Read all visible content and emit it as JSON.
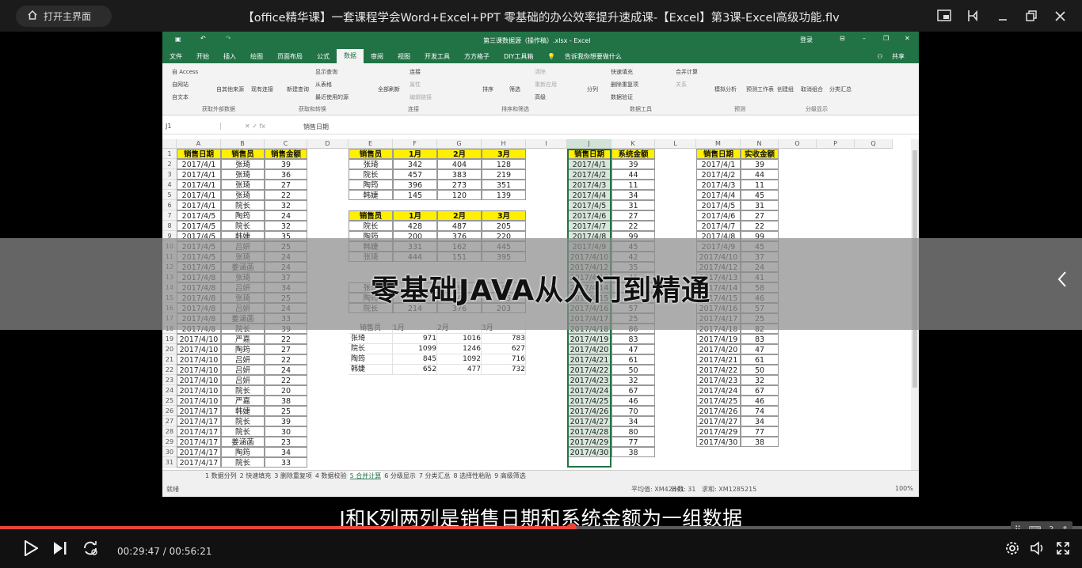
{
  "topbar": {
    "home_label": "打开主界面",
    "title": "【office精华课】一套课程学会Word+Excel+PPT  零基础的办公效率提升速成课-【Excel】第3课-Excel高级功能.flv"
  },
  "excel": {
    "doc_title": "第三课数据源（操作稿）.xlsx - Excel",
    "login": "登录",
    "share": "共享",
    "tabs": [
      "文件",
      "开始",
      "插入",
      "绘图",
      "页面布局",
      "公式",
      "数据",
      "审阅",
      "视图",
      "开发工具",
      "方方格子",
      "DIY工具箱"
    ],
    "active_tab": "数据",
    "tell_me": "告诉我你想要做什么",
    "ribbon_groups": [
      "获取外部数据",
      "获取和转换",
      "连接",
      "排序和筛选",
      "数据工具",
      "预测",
      "分级显示"
    ],
    "ribbon_items": [
      "自 Access",
      "自网站",
      "自文本",
      "自其他来源",
      "现有连接",
      "新建查询",
      "显示查询",
      "从表格",
      "最近使用的源",
      "全部刷新",
      "连接",
      "属性",
      "编辑链接",
      "排序",
      "筛选",
      "清除",
      "重新应用",
      "高级",
      "分列",
      "快速填充",
      "删除重复项",
      "数据验证",
      "合并计算",
      "关系",
      "模拟分析",
      "预测工作表",
      "创建组",
      "取消组合",
      "分类汇总"
    ],
    "name_box": "J1",
    "formula": "销售日期",
    "col_letters": [
      "A",
      "B",
      "C",
      "D",
      "E",
      "F",
      "G",
      "H",
      "I",
      "J",
      "K",
      "L",
      "M",
      "N",
      "O",
      "P",
      "Q"
    ],
    "table1_headers": [
      "销售日期",
      "销售员",
      "销售金额"
    ],
    "table1_rows": [
      [
        "2017/4/1",
        "张琦",
        "39"
      ],
      [
        "2017/4/1",
        "张琦",
        "36"
      ],
      [
        "2017/4/1",
        "张琦",
        "27"
      ],
      [
        "2017/4/1",
        "张琦",
        "22"
      ],
      [
        "2017/4/1",
        "院长",
        "32"
      ],
      [
        "2017/4/5",
        "陶筠",
        "24"
      ],
      [
        "2017/4/5",
        "院长",
        "32"
      ],
      [
        "2017/4/5",
        "韩婕",
        "35"
      ],
      [
        "2017/4/5",
        "吕妍",
        "25"
      ],
      [
        "2017/4/5",
        "张琦",
        "24"
      ],
      [
        "2017/4/5",
        "姜涵菡",
        "24"
      ],
      [
        "2017/4/8",
        "张琦",
        "37"
      ],
      [
        "2017/4/8",
        "吕妍",
        "34"
      ],
      [
        "2017/4/8",
        "张琦",
        "25"
      ],
      [
        "2017/4/8",
        "吕妍",
        "24"
      ],
      [
        "2017/4/8",
        "姜涵菡",
        "33"
      ],
      [
        "2017/4/8",
        "院长",
        "39"
      ],
      [
        "2017/4/10",
        "严嘉",
        "22"
      ],
      [
        "2017/4/10",
        "陶筠",
        "27"
      ],
      [
        "2017/4/10",
        "吕妍",
        "22"
      ],
      [
        "2017/4/10",
        "吕妍",
        "24"
      ],
      [
        "2017/4/10",
        "吕妍",
        "22"
      ],
      [
        "2017/4/10",
        "院长",
        "20"
      ],
      [
        "2017/4/10",
        "严嘉",
        "38"
      ],
      [
        "2017/4/17",
        "韩婕",
        "25"
      ],
      [
        "2017/4/17",
        "院长",
        "39"
      ],
      [
        "2017/4/17",
        "院长",
        "30"
      ],
      [
        "2017/4/17",
        "姜涵菡",
        "23"
      ],
      [
        "2017/4/17",
        "陶筠",
        "34"
      ],
      [
        "2017/4/17",
        "院长",
        "33"
      ]
    ],
    "table2_headers": [
      "销售员",
      "1月",
      "2月",
      "3月"
    ],
    "table2_rows": [
      [
        "张琦",
        "342",
        "404",
        "128"
      ],
      [
        "院长",
        "457",
        "383",
        "219"
      ],
      [
        "陶筠",
        "396",
        "273",
        "351"
      ],
      [
        "韩婕",
        "145",
        "120",
        "139"
      ]
    ],
    "table3_headers": [
      "销售员",
      "1月",
      "2月",
      "3月"
    ],
    "table3_rows": [
      [
        "院长",
        "428",
        "487",
        "205"
      ],
      [
        "陶筠",
        "200",
        "376",
        "220"
      ],
      [
        "韩婕",
        "331",
        "162",
        "445"
      ],
      [
        "张琦",
        "444",
        "151",
        "395"
      ]
    ],
    "table4_rows": [
      [
        "张琦",
        "113",
        "195",
        "140"
      ],
      [
        "陶筠",
        "249",
        "443",
        "145"
      ],
      [
        "院长",
        "214",
        "376",
        "203"
      ]
    ],
    "table5_headers": [
      "销售员",
      "1月",
      "2月",
      "3月"
    ],
    "table5_rows": [
      [
        "张琦",
        "971",
        "1016",
        "783"
      ],
      [
        "院长",
        "1099",
        "1246",
        "627"
      ],
      [
        "陶筠",
        "845",
        "1092",
        "716"
      ],
      [
        "韩婕",
        "652",
        "477",
        "732"
      ]
    ],
    "tableJ_headers": [
      "销售日期",
      "系统金额"
    ],
    "tableJ_rows": [
      [
        "2017/4/1",
        "39"
      ],
      [
        "2017/4/2",
        "44"
      ],
      [
        "2017/4/3",
        "11"
      ],
      [
        "2017/4/4",
        "34"
      ],
      [
        "2017/4/5",
        "31"
      ],
      [
        "2017/4/6",
        "27"
      ],
      [
        "2017/4/7",
        "22"
      ],
      [
        "2017/4/8",
        "99"
      ],
      [
        "2017/4/9",
        "45"
      ],
      [
        "2017/4/10",
        "42"
      ],
      [
        "2017/4/12",
        "35"
      ],
      [
        "2017/4/13",
        "46"
      ],
      [
        "2017/4/14",
        "58"
      ],
      [
        "2017/4/15",
        "46"
      ],
      [
        "2017/4/16",
        "57"
      ],
      [
        "2017/4/17",
        "25"
      ],
      [
        "2017/4/18",
        "86"
      ],
      [
        "2017/4/19",
        "83"
      ],
      [
        "2017/4/20",
        "47"
      ],
      [
        "2017/4/21",
        "61"
      ],
      [
        "2017/4/22",
        "50"
      ],
      [
        "2017/4/23",
        "32"
      ],
      [
        "2017/4/24",
        "67"
      ],
      [
        "2017/4/25",
        "46"
      ],
      [
        "2017/4/26",
        "70"
      ],
      [
        "2017/4/27",
        "34"
      ],
      [
        "2017/4/28",
        "80"
      ],
      [
        "2017/4/29",
        "77"
      ],
      [
        "2017/4/30",
        "38"
      ]
    ],
    "tableM_headers": [
      "销售日期",
      "实收金额"
    ],
    "tableM_rows": [
      [
        "2017/4/1",
        "39"
      ],
      [
        "2017/4/2",
        "44"
      ],
      [
        "2017/4/3",
        "11"
      ],
      [
        "2017/4/4",
        "45"
      ],
      [
        "2017/4/5",
        "31"
      ],
      [
        "2017/4/6",
        "27"
      ],
      [
        "2017/4/7",
        "22"
      ],
      [
        "2017/4/8",
        "99"
      ],
      [
        "2017/4/9",
        "45"
      ],
      [
        "2017/4/10",
        "37"
      ],
      [
        "2017/4/12",
        "24"
      ],
      [
        "2017/4/13",
        "41"
      ],
      [
        "2017/4/14",
        "58"
      ],
      [
        "2017/4/15",
        "46"
      ],
      [
        "2017/4/16",
        "57"
      ],
      [
        "2017/4/17",
        "25"
      ],
      [
        "2017/4/18",
        "82"
      ],
      [
        "2017/4/19",
        "83"
      ],
      [
        "2017/4/20",
        "47"
      ],
      [
        "2017/4/21",
        "61"
      ],
      [
        "2017/4/22",
        "50"
      ],
      [
        "2017/4/23",
        "32"
      ],
      [
        "2017/4/24",
        "67"
      ],
      [
        "2017/4/25",
        "46"
      ],
      [
        "2017/4/26",
        "74"
      ],
      [
        "2017/4/27",
        "34"
      ],
      [
        "2017/4/29",
        "77"
      ],
      [
        "2017/4/30",
        "38"
      ]
    ],
    "sheet_tabs": [
      "1 数据分列",
      "2 快速填充",
      "3 删除重复项",
      "4 数据校验",
      "5 合并计算",
      "6 分级显示",
      "7 分类汇总",
      "8 选择性粘贴",
      "9 高级筛选"
    ],
    "active_sheet": "5 合并计算",
    "status_ready": "就绪",
    "status_avg": "平均值: XM42841",
    "status_count": "计数: 31",
    "status_sum": "求和: XM1285215",
    "zoom": "100%"
  },
  "overlay": {
    "banner_text": "零基础JAVA从入门到精通",
    "subtitle": "J和K列两列是销售日期和系统金额为一组数据"
  },
  "player": {
    "time": "00:29:47 / 00:56:21",
    "progress_fraction": 0.5286,
    "accent": "#e8453c"
  }
}
